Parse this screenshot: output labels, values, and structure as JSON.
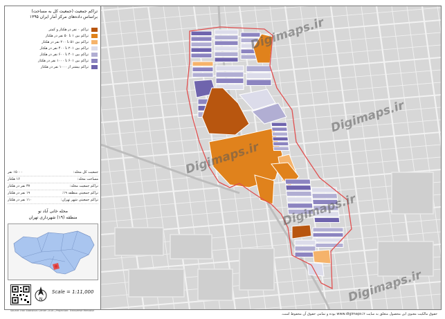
{
  "title": {
    "line1": "تراکم جمعیت (جمعیت کل به مساحت)",
    "line2": "براساس داده‌های مرکز آمار ایران ۱۳۹۵"
  },
  "legend": [
    {
      "label": "تراکم ۰ نفر در هکتار و کمتر",
      "color": "#b8560f"
    },
    {
      "label": "تراکم بین ۱ تا ۵۰ نفر در هکتار",
      "color": "#e0821c"
    },
    {
      "label": "تراکم بین ۵۱ تا ۲۰۰ نفر در هکتار",
      "color": "#f5b36b"
    },
    {
      "label": "تراکم بین ۲۰۱ تا ۴۰۰ نفر در هکتار",
      "color": "#dcdcea"
    },
    {
      "label": "تراکم بین ۴۰۱ تا ۶۰۰ نفر در هکتار",
      "color": "#b1aed3"
    },
    {
      "label": "تراکم بین ۶۰۱ تا ۱۰۰۰ نفر در هکتار",
      "color": "#8c84c0"
    },
    {
      "label": "تراکم بیشتر از ۱۰۰۰ نفر در هکتار",
      "color": "#6f64ad"
    }
  ],
  "stats": [
    {
      "label": "جمعیت کل محله:",
      "value": "۱۵۰۰۰ نفر"
    },
    {
      "label": "مساحت محله:",
      "value": "۱۶ هکتار"
    },
    {
      "label": "تراکم جمعیت محله:",
      "value": "۳۷ نفر در هکتار"
    },
    {
      "label": "تراکم جمعیتی منطقه ۱۹:",
      "value": "۱۹ نفر در هکتار"
    },
    {
      "label": "تراکم جمعیتی شهر تهران:",
      "value": "۱۱۰ نفر در هکتار"
    }
  ],
  "location": {
    "neighborhood": "محله خانی آباد نو",
    "district": "منطقه (۱۹) شهرداری تهران"
  },
  "scale": "Scale = 1:11,000",
  "north_label": "N",
  "credit": "Source: Iran Statistical Center 2016 | Projection: Transverse Mercator",
  "footer": "حقوق مالکیت معنوی این محصول متعلق به سایت www.digimaps.ir بوده و تمامی حقوق آن محفوظ است.",
  "watermark": "Digimaps.ir",
  "icons": [
    "north-arrow-icon",
    "qr-code-icon"
  ],
  "colors": {
    "boundary": "#e05050",
    "map_bg": "#d7d7d7",
    "streets": "#f2f2f2"
  }
}
